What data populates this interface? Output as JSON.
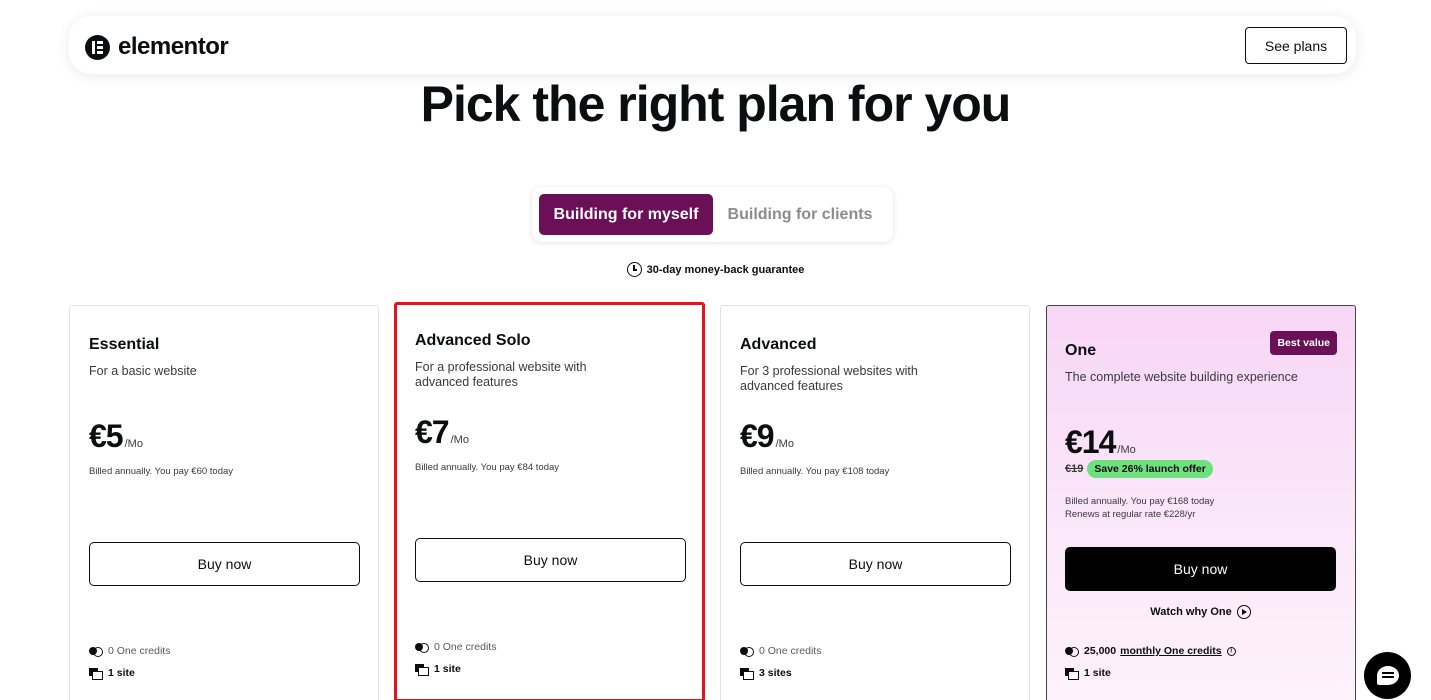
{
  "nav": {
    "brand": "elementor",
    "cta": "See plans"
  },
  "headline": "Pick the right plan for you",
  "toggle": {
    "active": "Building for myself",
    "inactive": "Building for clients"
  },
  "guarantee": "30-day money-back guarantee",
  "plans": [
    {
      "name": "Essential",
      "desc": "For a basic website",
      "price": "€5",
      "unit": "/Mo",
      "billed": "Billed annually. You pay €60 today",
      "cta": "Buy now",
      "credits": "0 One credits",
      "sites": "1 site"
    },
    {
      "name": "Advanced Solo",
      "desc": "For a professional website with advanced features",
      "price": "€7",
      "unit": "/Mo",
      "billed": "Billed annually. You pay €84 today",
      "cta": "Buy now",
      "credits": "0 One credits",
      "sites": "1 site"
    },
    {
      "name": "Advanced",
      "desc": "For 3 professional websites with advanced features",
      "price": "€9",
      "unit": "/Mo",
      "billed": "Billed annually. You pay €108 today",
      "cta": "Buy now",
      "credits": "0 One credits",
      "sites": "3 sites"
    },
    {
      "name": "One",
      "badge": "Best value",
      "desc": "The complete website building experience",
      "price": "€14",
      "unit": "/Mo",
      "original_price": "€19",
      "offer": "Save 26% launch offer",
      "billed": "Billed annually. You pay €168 today",
      "renews": "Renews at regular rate €228/yr",
      "cta": "Buy now",
      "watch": "Watch why One",
      "credits_prefix": "25,000",
      "credits_link": "monthly One credits",
      "sites": "1 site"
    }
  ],
  "colors": {
    "brand": "#6b0f56",
    "highlight_border": "#e8121b",
    "offer_green": "#6fe07e"
  },
  "icons": {
    "logo": "elementor-logo-icon",
    "clock": "clock-icon",
    "play": "play-circle-icon",
    "credits": "credits-icon",
    "sites": "site-icon",
    "info": "info-icon",
    "chat": "chat-icon"
  }
}
